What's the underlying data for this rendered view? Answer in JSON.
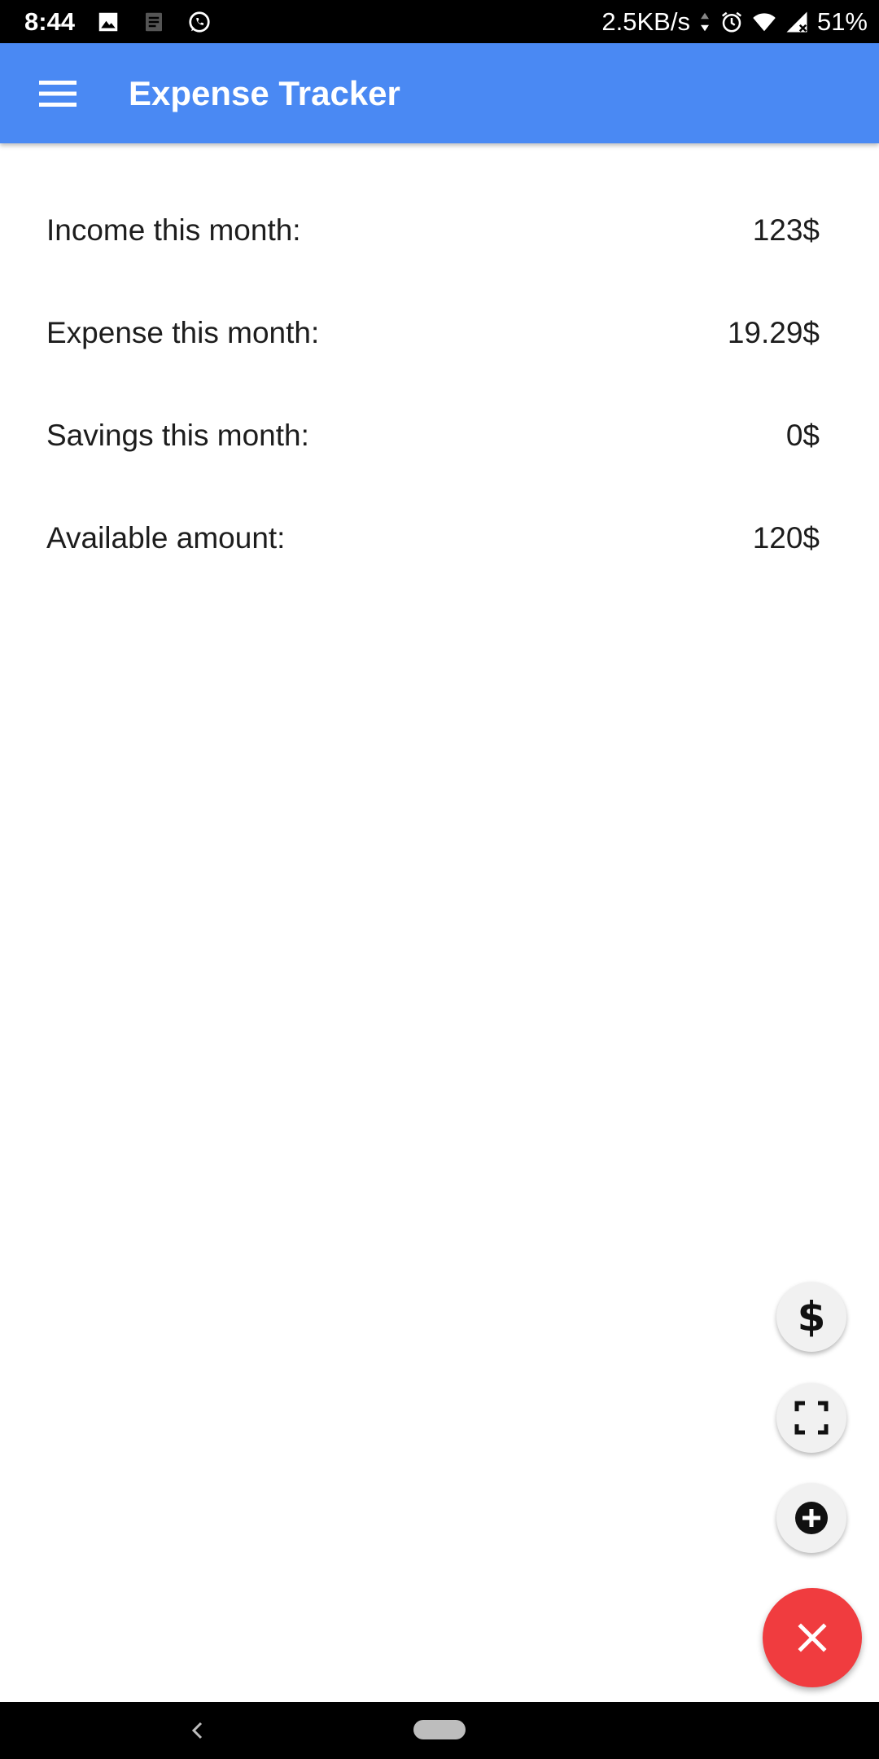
{
  "status_bar": {
    "time": "8:44",
    "network_speed": "2.5KB/s",
    "battery": "51%",
    "icons_left": [
      "image-icon",
      "notes-icon",
      "whatsapp-icon"
    ],
    "icons_right": [
      "data-arrows-icon",
      "alarm-icon",
      "wifi-icon",
      "signal-icon",
      "battery-icon"
    ]
  },
  "app_bar": {
    "title": "Expense Tracker",
    "menu_icon": "hamburger-menu-icon",
    "color": "#4a89f3"
  },
  "summary": {
    "rows": [
      {
        "label": "Income this month:",
        "value": "123$"
      },
      {
        "label": "Expense this month:",
        "value": "19.29$"
      },
      {
        "label": "Savings this month:",
        "value": "0$"
      },
      {
        "label": "Available amount:",
        "value": "120$"
      }
    ]
  },
  "fabs": {
    "items": [
      {
        "name": "dollar-icon",
        "symbol": "$"
      },
      {
        "name": "scan-frame-icon"
      },
      {
        "name": "add-circle-icon"
      }
    ],
    "main": {
      "name": "close-icon",
      "color": "#f03c3f"
    }
  },
  "nav_bar": {
    "icons": [
      "back-icon",
      "home-pill-icon"
    ]
  }
}
